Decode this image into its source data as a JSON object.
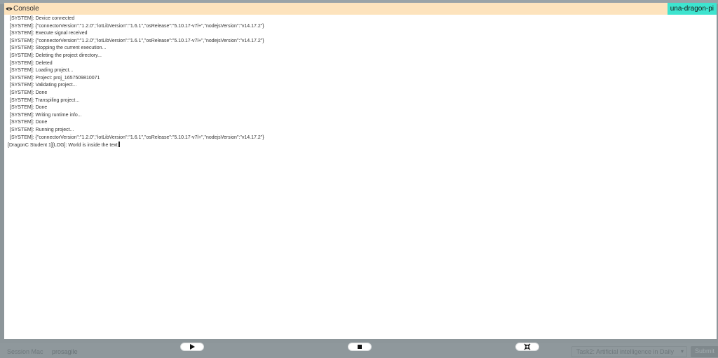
{
  "console": {
    "title": "Console",
    "device": "una-dragon-pi",
    "lines": [
      "[SYSTEM]: Device connected",
      "[SYSTEM]: {\"connectorVersion\":\"1.2.0\",\"iotLibVersion\":\"1.6.1\",\"osRelease\":\"5.10.17-v7l+\",\"nodejsVersion\":\"v14.17.2\"}",
      "[SYSTEM]: Execute signal received",
      "[SYSTEM]: {\"connectorVersion\":\"1.2.0\",\"iotLibVersion\":\"1.6.1\",\"osRelease\":\"5.10.17-v7l+\",\"nodejsVersion\":\"v14.17.2\"}",
      "[SYSTEM]: Stopping the current execution...",
      "[SYSTEM]: Deleting the project directory...",
      "[SYSTEM]: Deleted",
      "[SYSTEM]: Loading project...",
      "[SYSTEM]: Project: proj_1657509810071",
      "[SYSTEM]: Validating project...",
      "[SYSTEM]: Done",
      "[SYSTEM]: Transpiling project...",
      "[SYSTEM]: Done",
      "[SYSTEM]: Writing runtime info...",
      "[SYSTEM]: Done",
      "[SYSTEM]: Running project...",
      "[SYSTEM]: {\"connectorVersion\":\"1.2.0\",\"iotLibVersion\":\"1.6.1\",\"osRelease\":\"5.10.17-v7l+\",\"nodejsVersion\":\"v14.17.2\"}"
    ],
    "last_line": "[DragonC Student 1][LOG]: World is inside the text"
  },
  "controls": {
    "play_icon": "play-icon",
    "stop_icon": "stop-icon",
    "collapse_icon": "collapse-icon"
  },
  "background": {
    "field_label": "Session Mac",
    "field_value": "prosagile",
    "select_value": "Task2: Artificial intelligence in Daily",
    "submit_label": "Submit"
  },
  "colors": {
    "header_bg": "#fde3bd",
    "device_badge_bg": "#3ee4cf",
    "overlay": "#8d969a"
  }
}
